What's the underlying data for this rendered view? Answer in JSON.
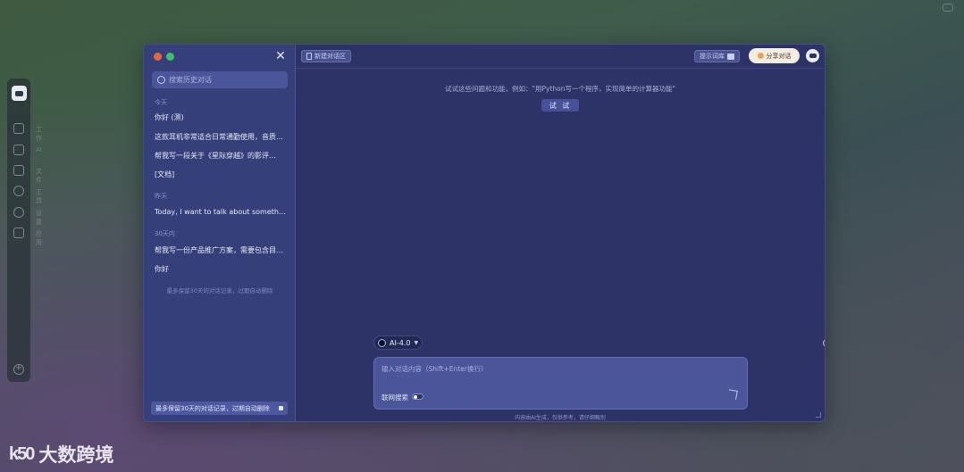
{
  "rail": {
    "labels": [
      "工作",
      "AI",
      "文件",
      "工具",
      "设置",
      "应用"
    ]
  },
  "watermark": {
    "logo": "k50",
    "text": "大数跨境"
  },
  "sidebar": {
    "search_placeholder": "搜索历史对话",
    "groups": [
      {
        "title": "今天",
        "items": [
          "你好 (测)",
          "这款耳机非常适合日常通勤使用，音质清晰，续航也非常出色…",
          "帮我写一段关于《星际穿越》的影评…",
          "[文档]"
        ]
      },
      {
        "title": "昨天",
        "items": [
          "Today, I want to talk about something important"
        ]
      },
      {
        "title": "30天内",
        "items": [
          "帮我写一份产品推广方案，需要包含目标人群、营销渠道…",
          "你好"
        ]
      }
    ],
    "note": "最多保留30天的对话记录，过期自动删除",
    "footer": "最多保留30天的对话记录，过期自动删除"
  },
  "topbar": {
    "doc_button": "新建对话区",
    "gift_button": "提示词库",
    "share_button": "分享对话",
    "colors": {
      "accent": "#f3ece2"
    }
  },
  "main": {
    "hint": "试试这些问题和功能，例如：\"用Python写一个程序，实现简单的计算器功能\"",
    "try_label": "试 试"
  },
  "composer": {
    "model_label": "AI-4.0",
    "placeholder": "输入对话内容（Shift+Enter换行）",
    "web_toggle_label": "联网搜索",
    "disclaimer": "内容由AI生成，仅供参考，请仔细甄别"
  }
}
